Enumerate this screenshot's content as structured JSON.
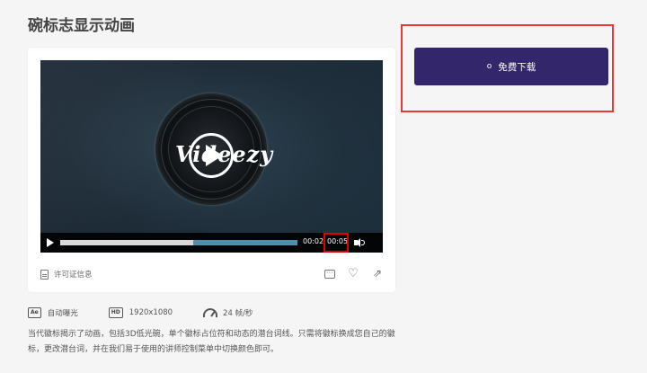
{
  "page": {
    "title": "碗标志显示动画"
  },
  "player": {
    "watermark": "Videezy",
    "current_time": "00:02",
    "duration": "00:05",
    "progress": 0.56
  },
  "card": {
    "license_label": "许可证信息",
    "icons": [
      "comment-icon",
      "heart-icon",
      "share-icon"
    ]
  },
  "meta": {
    "format_badge": "Ae",
    "format_label": "自动曝光",
    "resolution_badge": "HD",
    "resolution": "1920x1080",
    "fps_label": "24 帧/秒"
  },
  "description": "当代徽标揭示了动画，包括3D低光碗，单个徽标占位符和动态的潜台词线。只需将徽标换成您自己的徽标，更改潜台词，并在我们易于使用的讲师控制菜单中切换颜色即可。",
  "download": {
    "icon_text": "o",
    "label": "免费下载"
  },
  "colors": {
    "accent": "#33266a",
    "highlight": "#e53935"
  }
}
